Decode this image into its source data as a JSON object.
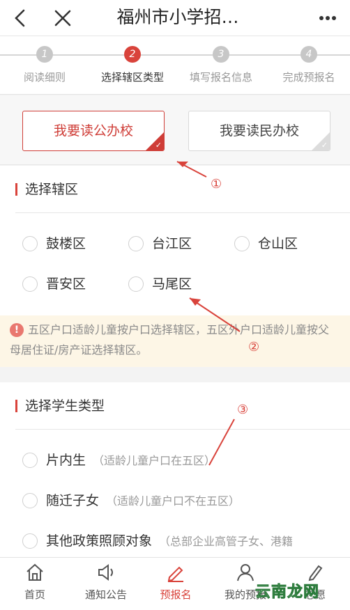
{
  "header": {
    "title": "福州市小学招…",
    "back_icon": "chevron-left-icon",
    "close_icon": "close-icon",
    "more_icon": "more-dots-icon"
  },
  "steps": [
    {
      "num": "1",
      "label": "阅读细则"
    },
    {
      "num": "2",
      "label": "选择辖区类型"
    },
    {
      "num": "3",
      "label": "填写报名信息"
    },
    {
      "num": "4",
      "label": "完成预报名"
    }
  ],
  "active_step": 2,
  "school_type": {
    "public_label": "我要读公办校",
    "private_label": "我要读民办校",
    "selected": "public"
  },
  "district": {
    "heading": "选择辖区",
    "options": [
      "鼓楼区",
      "台江区",
      "仓山区",
      "晋安区",
      "马尾区"
    ]
  },
  "notice": {
    "text": "五区户口适龄儿童按户口选择辖区，五区外户口适龄儿童按父母居住证/房产证选择辖区。"
  },
  "student_type": {
    "heading": "选择学生类型",
    "options": [
      {
        "label": "片内生",
        "desc": "（适龄儿童户口在五区）"
      },
      {
        "label": "随迁子女",
        "desc": "（适龄儿童户口不在五区）"
      },
      {
        "label": "其他政策照顾对象",
        "desc": "（总部企业高管子女、港籍"
      }
    ]
  },
  "tabs": [
    {
      "label": "首页",
      "icon": "home-icon"
    },
    {
      "label": "通知公告",
      "icon": "speaker-icon"
    },
    {
      "label": "预报名",
      "icon": "pen-icon"
    },
    {
      "label": "我的预报",
      "icon": "user-icon"
    },
    {
      "label": "志愿",
      "icon": "edit-icon"
    }
  ],
  "annotations": {
    "one": "①",
    "two": "②",
    "three": "③"
  },
  "watermark": "云南龙网",
  "colors": {
    "accent": "#d9433b",
    "notice_bg": "#fdf6e6",
    "page_bg": "#f3f3f3"
  }
}
